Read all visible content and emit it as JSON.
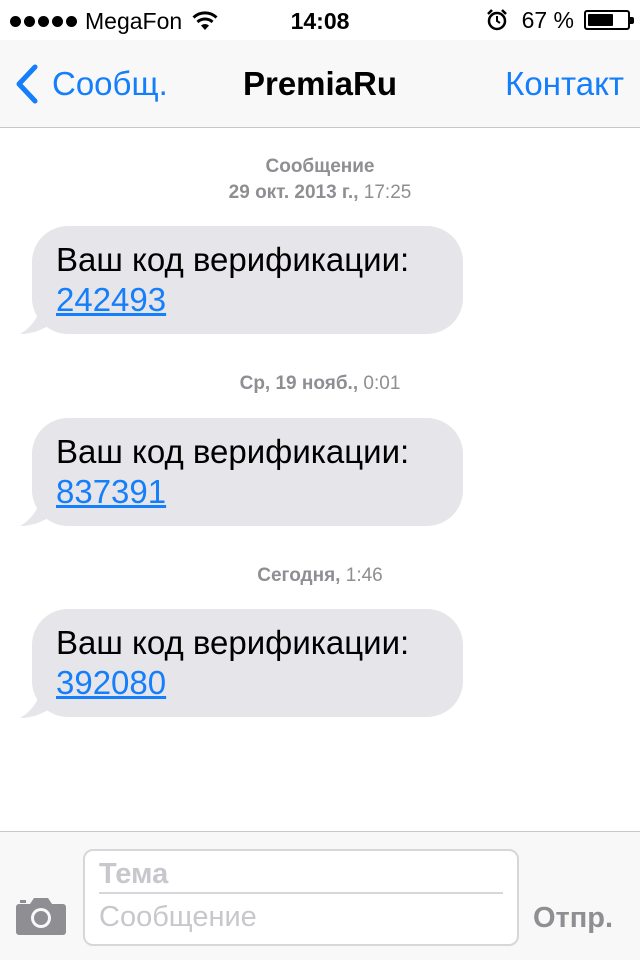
{
  "status_bar": {
    "carrier": "MegaFon",
    "time": "14:08",
    "battery_percent": "67 %",
    "battery_level": 0.67
  },
  "nav": {
    "back_label": "Сообщ.",
    "title": "PremiaRu",
    "contact_label": "Контакт"
  },
  "messages": [
    {
      "timestamp_line1": "Сообщение",
      "timestamp_bold": "29 окт. 2013 г.,",
      "timestamp_time": " 17:25",
      "text": "Ваш код верификации:",
      "code": "242493"
    },
    {
      "timestamp_bold": "Ср, 19 нояб.,",
      "timestamp_time": " 0:01",
      "text": "Ваш код верификации:",
      "code": "837391"
    },
    {
      "timestamp_bold": "Сегодня,",
      "timestamp_time": " 1:46",
      "text": "Ваш код верификации:",
      "code": "392080"
    }
  ],
  "composer": {
    "subject_placeholder": "Тема",
    "message_placeholder": "Сообщение",
    "send_label": "Отпр."
  },
  "colors": {
    "accent": "#147efb",
    "bubble": "#e5e5ea",
    "secondary_text": "#8e8e93"
  }
}
